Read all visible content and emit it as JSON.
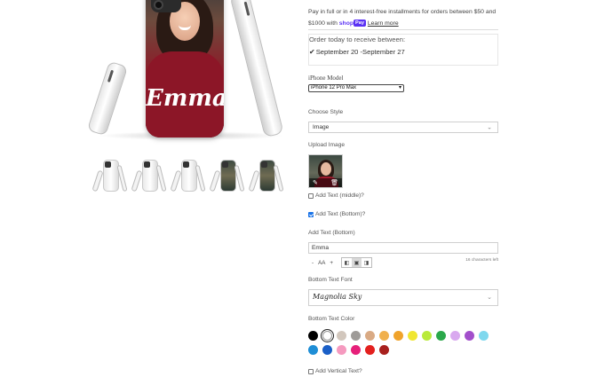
{
  "product": {
    "case_name": "Emma",
    "thumbnails": [
      {
        "name": "thumbnail-1",
        "style": "plain"
      },
      {
        "name": "thumbnail-2",
        "style": "plain"
      },
      {
        "name": "thumbnail-3",
        "style": "plain"
      },
      {
        "name": "thumbnail-4",
        "style": "photo"
      },
      {
        "name": "thumbnail-5",
        "style": "photo"
      }
    ]
  },
  "payment": {
    "line1": "Pay in full or in 4 interest-free installments for orders between $50 and",
    "line2_prefix": "$1000 with",
    "shop_word": "shop",
    "pay_badge": "Pay",
    "learn_more": "Learn more"
  },
  "delivery": {
    "title": "Order today to receive between:",
    "dates": "September 20 -September 27"
  },
  "iphone_model": {
    "label": "iPhone Model",
    "value": "iPhone 12 Pro Max"
  },
  "style": {
    "label": "Choose Style",
    "value": "Image"
  },
  "upload": {
    "label": "Upload Image",
    "edit_icon": "pencil-icon",
    "delete_icon": "trash-icon"
  },
  "add_text_middle": {
    "label": "Add Text (middle)?",
    "checked": false
  },
  "add_text_bottom": {
    "label": "Add Text (Bottom)?",
    "checked": true
  },
  "bottom_text": {
    "label": "Add Text (Bottom)",
    "value": "Emma",
    "minus": "-",
    "size": "AA",
    "plus": "+",
    "char_count": "16 characters left"
  },
  "bottom_font": {
    "label": "Bottom Text Font",
    "value": "Magnolia Sky"
  },
  "bottom_color": {
    "label": "Bottom Text Color",
    "row1": [
      "#000000",
      "#ffffff",
      "#d2c7bd",
      "#9e9b98",
      "#d9aa84",
      "#f0b04d",
      "#f0a32b",
      "#f0e631",
      "#b9ea3a",
      "#2aa84a",
      "#d9a9ef",
      "#a24fcb",
      "#7fd8ee"
    ],
    "row2": [
      "#1e8ed6",
      "#1a5fc7",
      "#f59abf",
      "#e6207a",
      "#e3201e",
      "#a8201e"
    ],
    "selected_index": 1
  },
  "add_vertical": {
    "label": "Add Vertical Text?",
    "checked": false
  }
}
